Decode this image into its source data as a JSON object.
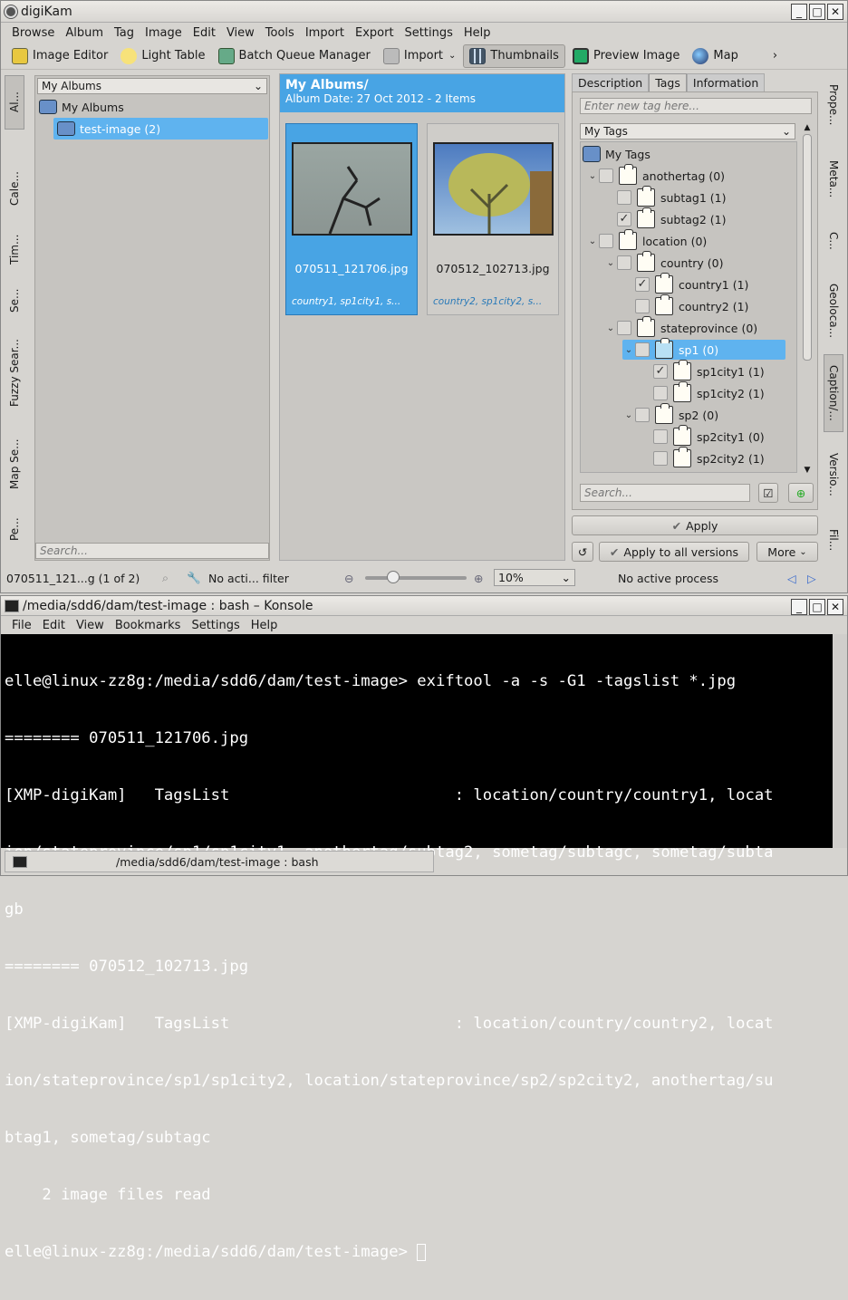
{
  "digikam": {
    "title": "digiKam",
    "menu": [
      "Browse",
      "Album",
      "Tag",
      "Image",
      "Edit",
      "View",
      "Tools",
      "Import",
      "Export",
      "Settings",
      "Help"
    ],
    "toolbar": {
      "image_editor": "Image Editor",
      "light_table": "Light Table",
      "batch_queue": "Batch Queue Manager",
      "import": "Import",
      "thumbnails": "Thumbnails",
      "preview": "Preview Image",
      "map": "Map"
    },
    "left_tabs": [
      "Al...",
      "Cale...",
      "Tim...",
      "Se...",
      "Fuzzy Sear...",
      "Map Se...",
      "Pe..."
    ],
    "albums": {
      "combo": "My Albums",
      "root": "My Albums",
      "child": "test-image (2)",
      "search_placeholder": "Search..."
    },
    "header": {
      "title": "My Albums/",
      "subtitle": "Album Date: 27 Oct 2012 - 2 Items"
    },
    "items": [
      {
        "name": "070511_121706.jpg",
        "tags": "country1, sp1city1, s..."
      },
      {
        "name": "070512_102713.jpg",
        "tags": "country2, sp1city2, s..."
      }
    ],
    "right_tabs": {
      "description": "Description",
      "tags": "Tags",
      "information": "Information"
    },
    "tag_input_placeholder": "Enter new tag here...",
    "tags_combo": "My Tags",
    "tag_tree": [
      {
        "label": "My Tags",
        "level": 0,
        "checked": false,
        "type": "root"
      },
      {
        "label": "anothertag (0)",
        "level": 1,
        "checked": false,
        "arrow": "v"
      },
      {
        "label": "subtag1 (1)",
        "level": 2,
        "checked": false
      },
      {
        "label": "subtag2 (1)",
        "level": 2,
        "checked": true
      },
      {
        "label": "location (0)",
        "level": 1,
        "checked": false,
        "arrow": "v"
      },
      {
        "label": "country (0)",
        "level": 2,
        "checked": false,
        "arrow": "v"
      },
      {
        "label": "country1 (1)",
        "level": 3,
        "checked": true
      },
      {
        "label": "country2 (1)",
        "level": 3,
        "checked": false
      },
      {
        "label": "stateprovince (0)",
        "level": 2,
        "checked": false,
        "arrow": "v"
      },
      {
        "label": "sp1 (0)",
        "level": 3,
        "checked": false,
        "arrow": "v",
        "selected": true
      },
      {
        "label": "sp1city1 (1)",
        "level": 4,
        "checked": true
      },
      {
        "label": "sp1city2 (1)",
        "level": 4,
        "checked": false
      },
      {
        "label": "sp2 (0)",
        "level": 3,
        "checked": false,
        "arrow": "v"
      },
      {
        "label": "sp2city1 (0)",
        "level": 4,
        "checked": false
      },
      {
        "label": "sp2city2 (1)",
        "level": 4,
        "checked": false
      }
    ],
    "tag_search_placeholder": "Search...",
    "apply": "Apply",
    "apply_all": "Apply to all versions",
    "more": "More",
    "far_right_tabs": [
      "Prope...",
      "Meta...",
      "C...",
      "Geoloca...",
      "Caption/...",
      "Versio...",
      "Fil..."
    ],
    "status": {
      "file": "070511_121...g (1 of 2)",
      "filter": "No acti... filter",
      "zoom": "10%",
      "process": "No active process"
    }
  },
  "konsole": {
    "title": "/media/sdd6/dam/test-image : bash – Konsole",
    "menu": [
      "File",
      "Edit",
      "View",
      "Bookmarks",
      "Settings",
      "Help"
    ],
    "lines": [
      "elle@linux-zz8g:/media/sdd6/dam/test-image> exiftool -a -s -G1 -tagslist *.jpg",
      "======== 070511_121706.jpg",
      "[XMP-digiKam]   TagsList                        : location/country/country1, locat",
      "ion/stateprovince/sp1/sp1city1, anothertag/subtag2, sometag/subtagc, sometag/subta",
      "gb",
      "======== 070512_102713.jpg",
      "[XMP-digiKam]   TagsList                        : location/country/country2, locat",
      "ion/stateprovince/sp1/sp1city2, location/stateprovince/sp2/sp2city2, anothertag/su",
      "btag1, sometag/subtagc",
      "    2 image files read",
      "elle@linux-zz8g:/media/sdd6/dam/test-image> "
    ],
    "tab_label": "/media/sdd6/dam/test-image : bash"
  },
  "colors": {
    "accent": "#48a4e4",
    "selection": "#5fb3ef"
  }
}
